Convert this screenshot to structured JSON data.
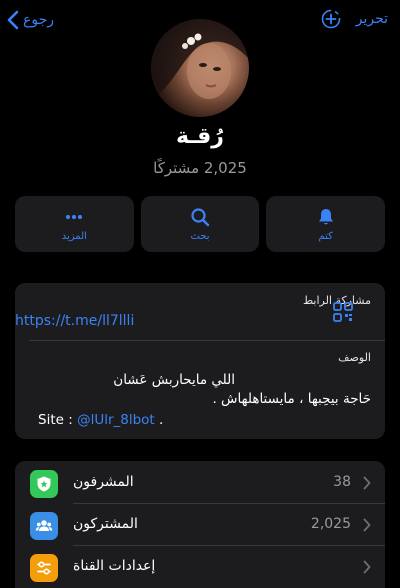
{
  "nav": {
    "back_label": "رجوع",
    "edit_label": "تحرير"
  },
  "channel": {
    "name": "رُقـة",
    "subscribers": "2,025 مشتركًا"
  },
  "actions": [
    {
      "label": "المزيد",
      "icon": "more-icon"
    },
    {
      "label": "بحث",
      "icon": "search-icon"
    },
    {
      "label": "كتم",
      "icon": "bell-icon"
    }
  ],
  "info": {
    "share_label": "مشاركة الرابط",
    "link": "https://t.me/ll7llli",
    "description_label": "الوصف",
    "description_lines": [
      "اللي مايحاربش عَشان",
      "حَاجة بيحِبها ، مايستاهلهاش ."
    ],
    "site_prefix": "Site : ",
    "site_link": "@lUlr_8lbot",
    "site_suffix": " ."
  },
  "rows": [
    {
      "title": "المشرفون",
      "value": "38",
      "icon": "admin-shield-icon",
      "color": "#34c759"
    },
    {
      "title": "المشتركون",
      "value": "2,025",
      "icon": "subscribers-icon",
      "color": "#3a8ee6"
    },
    {
      "title": "إعدادات القناة",
      "value": "",
      "icon": "settings-sliders-icon",
      "color": "#f59e0b"
    }
  ],
  "colors": {
    "accent": "#3b82f6",
    "card": "#1c1c1e",
    "background": "#000000"
  }
}
